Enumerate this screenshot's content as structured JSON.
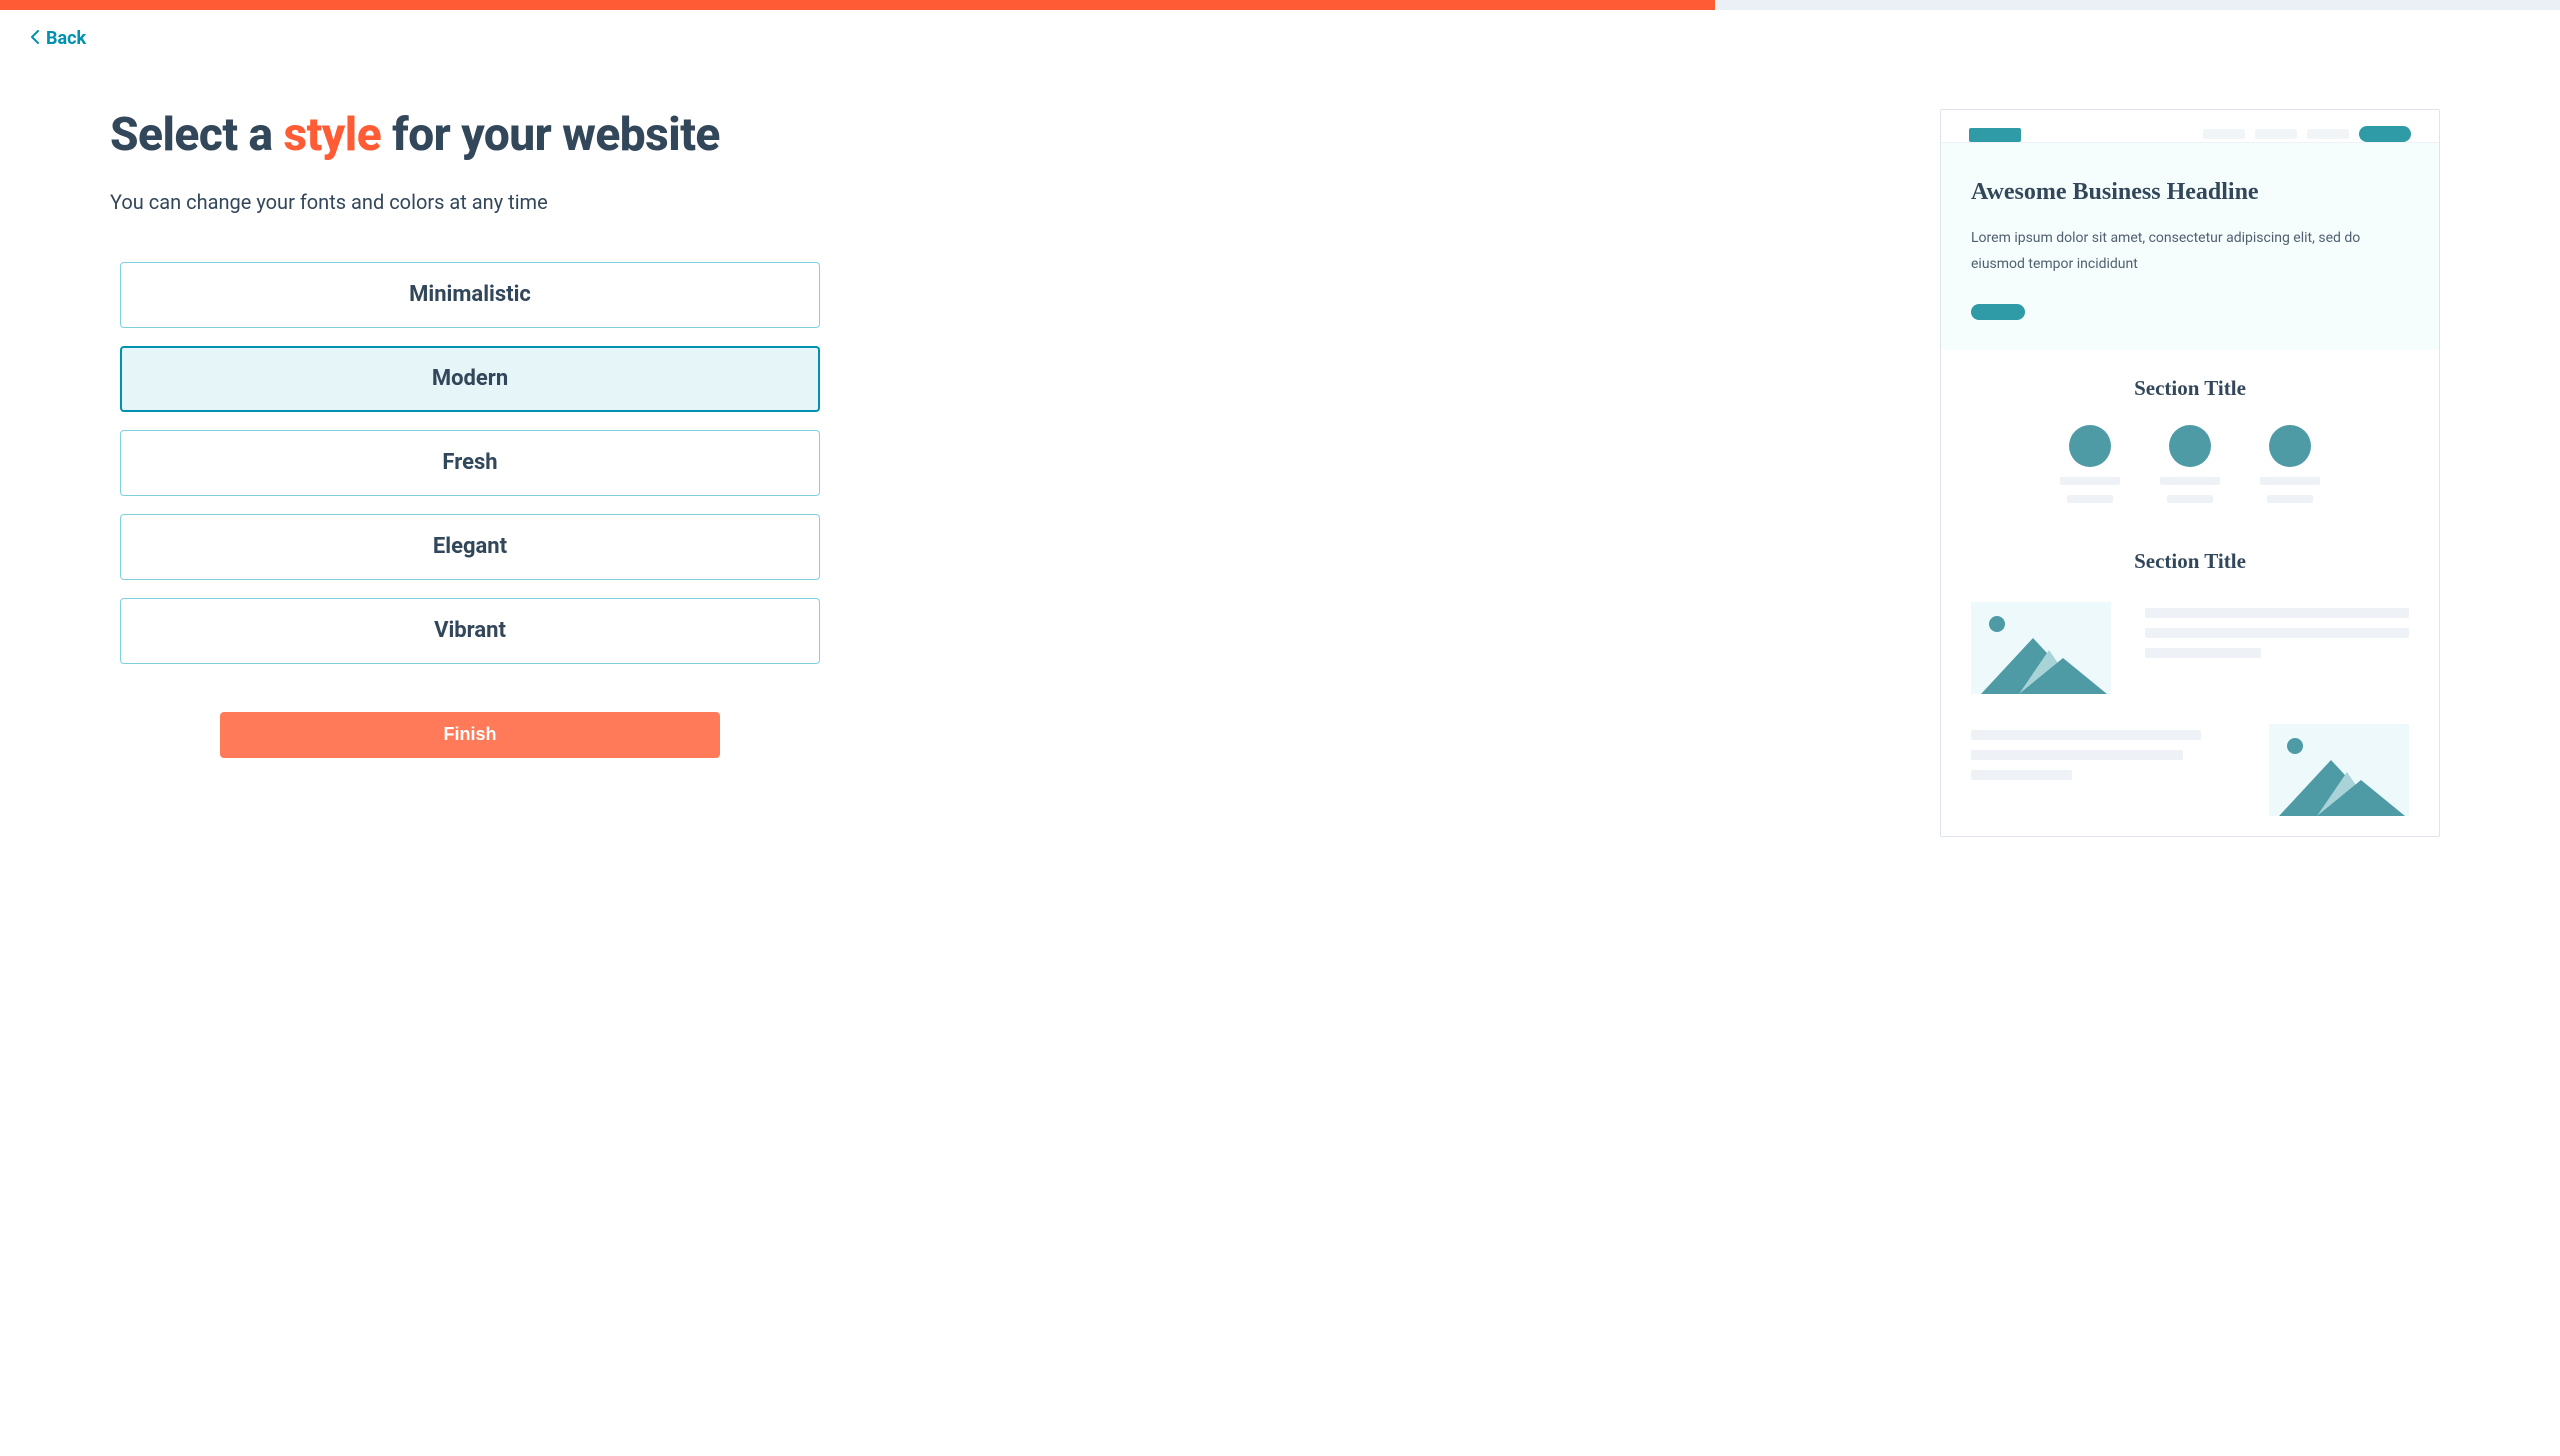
{
  "navigation": {
    "back_label": "Back"
  },
  "heading": {
    "pre": "Select a ",
    "accent": "style",
    "post": " for your website"
  },
  "subtitle": "You can change your fonts and colors at any time",
  "options": [
    {
      "label": "Minimalistic",
      "selected": false
    },
    {
      "label": "Modern",
      "selected": true
    },
    {
      "label": "Fresh",
      "selected": false
    },
    {
      "label": "Elegant",
      "selected": false
    },
    {
      "label": "Vibrant",
      "selected": false
    }
  ],
  "actions": {
    "finish_label": "Finish"
  },
  "preview": {
    "hero_title": "Awesome Business Headline",
    "hero_body": "Lorem ipsum dolor sit amet, consectetur adipiscing elit, sed do eiusmod tempor incididunt",
    "section_title_1": "Section Title",
    "section_title_2": "Section Title"
  },
  "progress": {
    "percent": 67
  },
  "colors": {
    "accent_orange": "#ff5c35",
    "button_orange": "#ff7a59",
    "teal": "#0091ae",
    "preview_teal": "#4e9ba6",
    "text": "#33475b"
  }
}
